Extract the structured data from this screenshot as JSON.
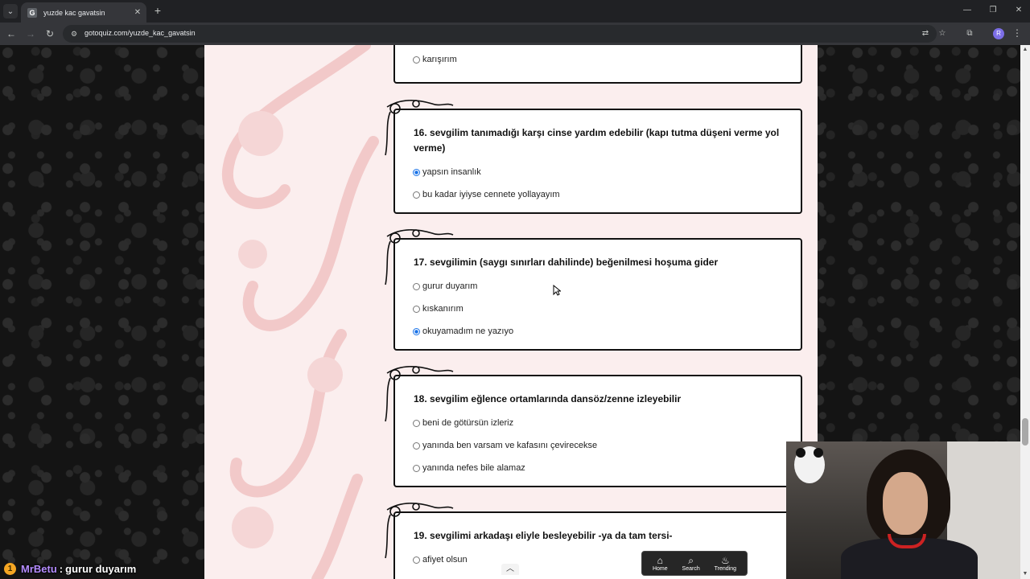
{
  "browser": {
    "tab_title": "yuzde kac gavatsin",
    "favicon_letter": "G",
    "url": "gotoquiz.com/yuzde_kac_gavatsin",
    "profile_initial": "R"
  },
  "questions": [
    {
      "number": "",
      "title": "",
      "options": [
        {
          "label": "karışırım",
          "checked": false
        }
      ]
    },
    {
      "number": "16.",
      "title": "sevgilim tanımadığı karşı cinse yardım edebilir (kapı tutma düşeni verme yol verme)",
      "options": [
        {
          "label": "yapsın insanlık",
          "checked": true
        },
        {
          "label": "bu kadar iyiyse cennete yollayayım",
          "checked": false
        }
      ]
    },
    {
      "number": "17.",
      "title": "sevgilimin (saygı sınırları dahilinde) beğenilmesi hoşuma gider",
      "options": [
        {
          "label": "gurur duyarım",
          "checked": false
        },
        {
          "label": "kıskanırım",
          "checked": false
        },
        {
          "label": "okuyamadım ne yazıyo",
          "checked": true
        }
      ]
    },
    {
      "number": "18.",
      "title": "sevgilim eğlence ortamlarında dansöz/zenne izleyebilir",
      "options": [
        {
          "label": "beni de götürsün izleriz",
          "checked": false
        },
        {
          "label": "yanında ben varsam ve kafasını çevirecekse",
          "checked": false
        },
        {
          "label": "yanında nefes bile alamaz",
          "checked": false
        }
      ]
    },
    {
      "number": "19.",
      "title": "sevgilimi arkadaşı eliyle besleyebilir -ya da tam tersi-",
      "options": [
        {
          "label": "afiyet olsun",
          "checked": false
        }
      ]
    }
  ],
  "bottom_nav": {
    "home": "Home",
    "search": "Search",
    "trending": "Trending"
  },
  "chat": {
    "badge": "1",
    "user": "MrBetu",
    "separator": ":",
    "message": "gurur duyarım",
    "user_color": "#b48cff"
  },
  "colors": {
    "page_column": "#fbeeee",
    "card_border": "#111111",
    "radio_checked": "#1a73e8"
  }
}
